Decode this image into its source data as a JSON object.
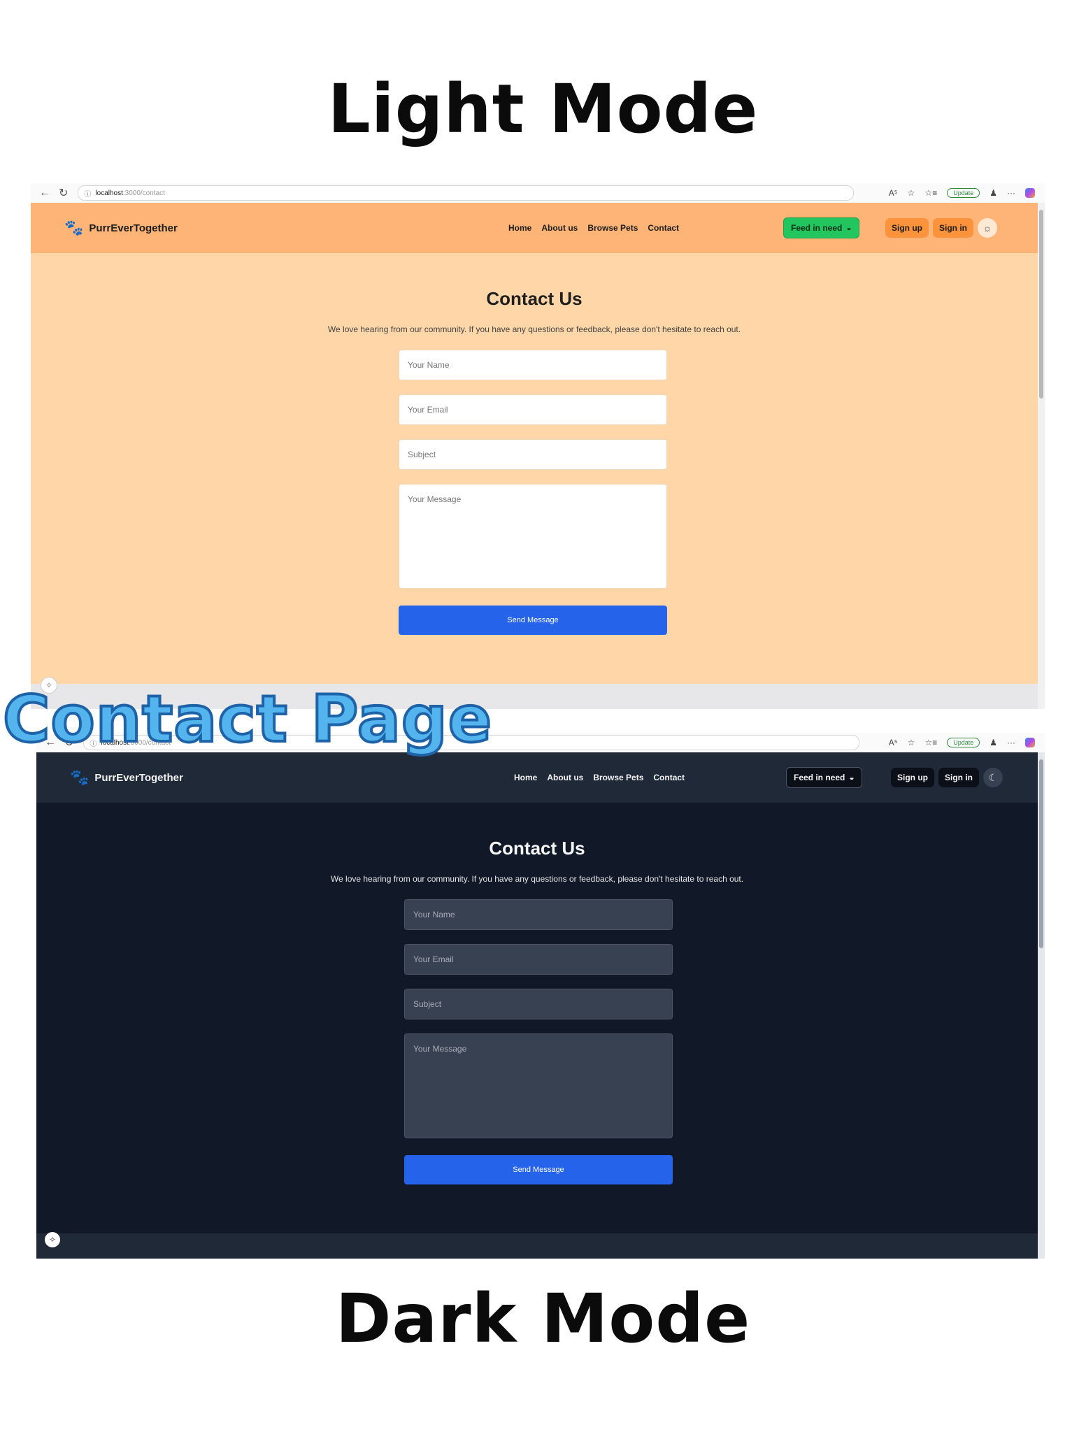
{
  "poster": {
    "top_title": "Light Mode",
    "center_label": "Contact Page",
    "bottom_title": "Dark Mode"
  },
  "browser": {
    "back": "←",
    "reload": "↻",
    "info": "ⓘ",
    "url_host": "localhost",
    "url_path": ":3000/contact",
    "read_aloud": "A⁵",
    "favorite": "☆",
    "favorites": "☆≡",
    "update_label": "Update",
    "profile": "♟",
    "more": "···"
  },
  "site": {
    "brand": "PurrEverTogether",
    "nav_links": [
      "Home",
      "About us",
      "Browse Pets",
      "Contact"
    ],
    "feed_label": "Feed in need",
    "signup": "Sign up",
    "signin": "Sign in",
    "theme_light_icon": "☼",
    "theme_dark_icon": "☾"
  },
  "contact": {
    "title": "Contact Us",
    "lead": "We love hearing from our community. If you have any questions or feedback, please don't hesitate to reach out.",
    "name_placeholder": "Your Name",
    "email_placeholder": "Your Email",
    "subject_placeholder": "Subject",
    "message_placeholder": "Your Message",
    "send_label": "Send Message"
  },
  "colors": {
    "light_navbar": "#fdb476",
    "light_page": "#fed6a8",
    "dark_navbar": "#1f2937",
    "dark_page": "#111827",
    "feed_green": "#22c55e",
    "auth_orange": "#fb923c",
    "send_blue": "#2563eb"
  }
}
